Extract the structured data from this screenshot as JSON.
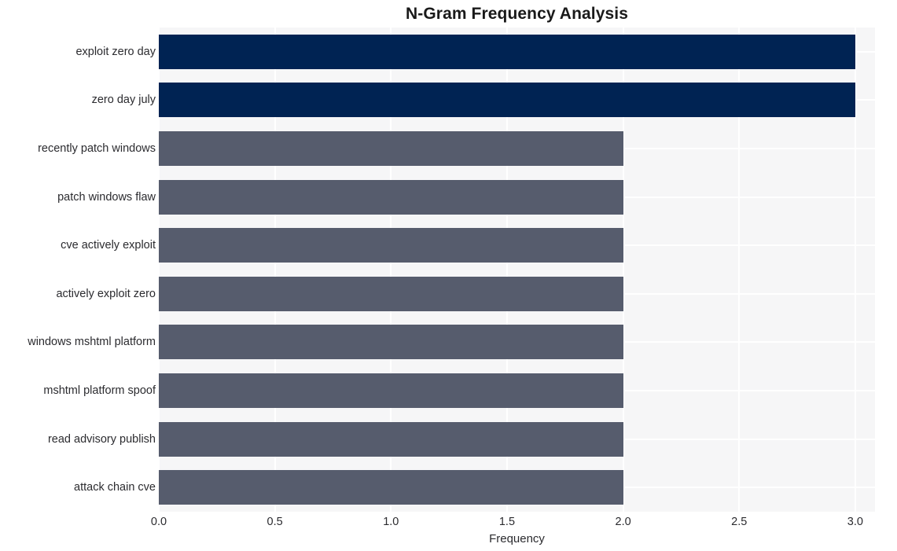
{
  "chart_data": {
    "type": "bar",
    "orientation": "horizontal",
    "title": "N-Gram Frequency Analysis",
    "xlabel": "Frequency",
    "ylabel": "",
    "categories": [
      "exploit zero day",
      "zero day july",
      "recently patch windows",
      "patch windows flaw",
      "cve actively exploit",
      "actively exploit zero",
      "windows mshtml platform",
      "mshtml platform spoof",
      "read advisory publish",
      "attack chain cve"
    ],
    "values": [
      3,
      3,
      2,
      2,
      2,
      2,
      2,
      2,
      2,
      2
    ],
    "bar_colors": [
      "#002353",
      "#002353",
      "#565c6d",
      "#565c6d",
      "#565c6d",
      "#565c6d",
      "#565c6d",
      "#565c6d",
      "#565c6d",
      "#565c6d"
    ],
    "xlim": [
      0,
      3.085
    ],
    "xticks": [
      0.0,
      0.5,
      1.0,
      1.5,
      2.0,
      2.5,
      3.0
    ],
    "xtick_labels": [
      "0.0",
      "0.5",
      "1.0",
      "1.5",
      "2.0",
      "2.5",
      "3.0"
    ],
    "grid": true,
    "grid_color": "#ffffff",
    "plot_background": "#f6f6f7",
    "figure_background": "#ffffff",
    "legend": null,
    "legend_position": "none",
    "text_color": "#2b2b2f",
    "title_color": "#1a1a1a"
  }
}
